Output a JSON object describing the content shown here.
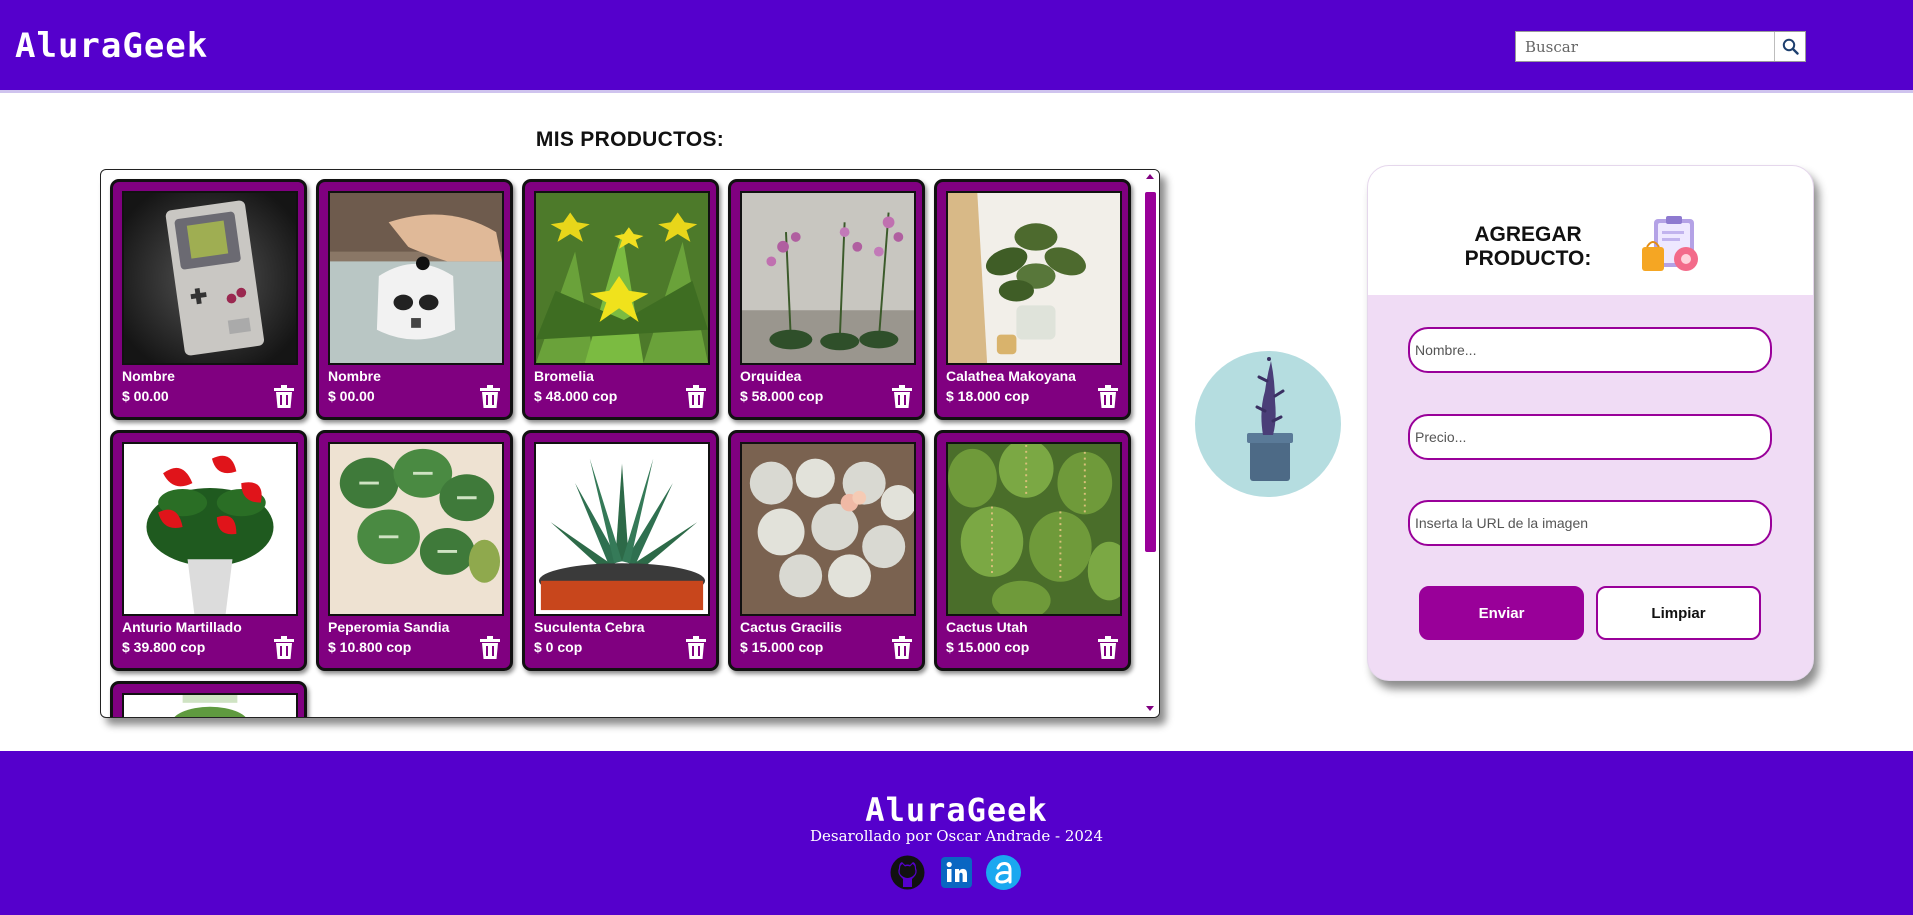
{
  "header": {
    "logo": "AluraGeek",
    "search_placeholder": "Buscar",
    "search_icon": "magnifier-icon"
  },
  "main": {
    "section_title": "MIS PRODUCTOS:",
    "products": [
      {
        "name": "Nombre",
        "price": "$ 00.00",
        "image": "gameboy"
      },
      {
        "name": "Nombre",
        "price": "$ 00.00",
        "image": "stormtrooper-mug"
      },
      {
        "name": "Bromelia",
        "price": "$ 48.000 cop",
        "image": "bromelia"
      },
      {
        "name": "Orquidea",
        "price": "$ 58.000 cop",
        "image": "orchid"
      },
      {
        "name": "Calathea Makoyana",
        "price": "$ 18.000 cop",
        "image": "calathea"
      },
      {
        "name": "Anturio Martillado",
        "price": "$ 39.800 cop",
        "image": "anthurium"
      },
      {
        "name": "Peperomia Sandia",
        "price": "$ 10.800 cop",
        "image": "peperomia"
      },
      {
        "name": "Suculenta Cebra",
        "price": "$ 0 cop",
        "image": "zebra-succulent"
      },
      {
        "name": "Cactus Gracilis",
        "price": "$ 15.000 cop",
        "image": "cactus-gracilis"
      },
      {
        "name": "Cactus Utah",
        "price": "$ 15.000 cop",
        "image": "cactus-utah"
      }
    ],
    "delete_icon": "trash-icon"
  },
  "form": {
    "title_line1": "AGREGAR",
    "title_line2": "PRODUCTO:",
    "name_placeholder": "Nombre...",
    "price_placeholder": "Precio...",
    "image_placeholder": "Inserta la URL de la imagen",
    "send_label": "Enviar",
    "clear_label": "Limpiar"
  },
  "footer": {
    "logo": "AluraGeek",
    "credit": "Desarollado por Oscar Andrade - 2024",
    "links": [
      "github-icon",
      "linkedin-icon",
      "alura-icon"
    ]
  },
  "colors": {
    "brand": "#5500cc",
    "card": "#800080",
    "accent": "#990099",
    "form_bg": "#f0dcf5"
  }
}
